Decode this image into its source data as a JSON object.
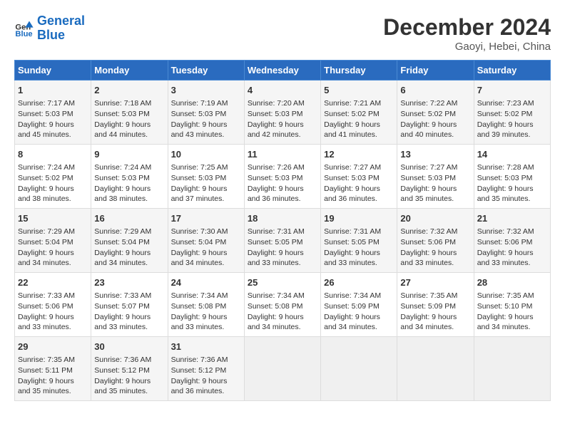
{
  "header": {
    "logo_line1": "General",
    "logo_line2": "Blue",
    "month": "December 2024",
    "location": "Gaoyi, Hebei, China"
  },
  "weekdays": [
    "Sunday",
    "Monday",
    "Tuesday",
    "Wednesday",
    "Thursday",
    "Friday",
    "Saturday"
  ],
  "weeks": [
    [
      {
        "day": "1",
        "sunrise": "7:17 AM",
        "sunset": "5:03 PM",
        "daylight": "9 hours and 45 minutes."
      },
      {
        "day": "2",
        "sunrise": "7:18 AM",
        "sunset": "5:03 PM",
        "daylight": "9 hours and 44 minutes."
      },
      {
        "day": "3",
        "sunrise": "7:19 AM",
        "sunset": "5:03 PM",
        "daylight": "9 hours and 43 minutes."
      },
      {
        "day": "4",
        "sunrise": "7:20 AM",
        "sunset": "5:03 PM",
        "daylight": "9 hours and 42 minutes."
      },
      {
        "day": "5",
        "sunrise": "7:21 AM",
        "sunset": "5:02 PM",
        "daylight": "9 hours and 41 minutes."
      },
      {
        "day": "6",
        "sunrise": "7:22 AM",
        "sunset": "5:02 PM",
        "daylight": "9 hours and 40 minutes."
      },
      {
        "day": "7",
        "sunrise": "7:23 AM",
        "sunset": "5:02 PM",
        "daylight": "9 hours and 39 minutes."
      }
    ],
    [
      {
        "day": "8",
        "sunrise": "7:24 AM",
        "sunset": "5:02 PM",
        "daylight": "9 hours and 38 minutes."
      },
      {
        "day": "9",
        "sunrise": "7:24 AM",
        "sunset": "5:03 PM",
        "daylight": "9 hours and 38 minutes."
      },
      {
        "day": "10",
        "sunrise": "7:25 AM",
        "sunset": "5:03 PM",
        "daylight": "9 hours and 37 minutes."
      },
      {
        "day": "11",
        "sunrise": "7:26 AM",
        "sunset": "5:03 PM",
        "daylight": "9 hours and 36 minutes."
      },
      {
        "day": "12",
        "sunrise": "7:27 AM",
        "sunset": "5:03 PM",
        "daylight": "9 hours and 36 minutes."
      },
      {
        "day": "13",
        "sunrise": "7:27 AM",
        "sunset": "5:03 PM",
        "daylight": "9 hours and 35 minutes."
      },
      {
        "day": "14",
        "sunrise": "7:28 AM",
        "sunset": "5:03 PM",
        "daylight": "9 hours and 35 minutes."
      }
    ],
    [
      {
        "day": "15",
        "sunrise": "7:29 AM",
        "sunset": "5:04 PM",
        "daylight": "9 hours and 34 minutes."
      },
      {
        "day": "16",
        "sunrise": "7:29 AM",
        "sunset": "5:04 PM",
        "daylight": "9 hours and 34 minutes."
      },
      {
        "day": "17",
        "sunrise": "7:30 AM",
        "sunset": "5:04 PM",
        "daylight": "9 hours and 34 minutes."
      },
      {
        "day": "18",
        "sunrise": "7:31 AM",
        "sunset": "5:05 PM",
        "daylight": "9 hours and 33 minutes."
      },
      {
        "day": "19",
        "sunrise": "7:31 AM",
        "sunset": "5:05 PM",
        "daylight": "9 hours and 33 minutes."
      },
      {
        "day": "20",
        "sunrise": "7:32 AM",
        "sunset": "5:06 PM",
        "daylight": "9 hours and 33 minutes."
      },
      {
        "day": "21",
        "sunrise": "7:32 AM",
        "sunset": "5:06 PM",
        "daylight": "9 hours and 33 minutes."
      }
    ],
    [
      {
        "day": "22",
        "sunrise": "7:33 AM",
        "sunset": "5:06 PM",
        "daylight": "9 hours and 33 minutes."
      },
      {
        "day": "23",
        "sunrise": "7:33 AM",
        "sunset": "5:07 PM",
        "daylight": "9 hours and 33 minutes."
      },
      {
        "day": "24",
        "sunrise": "7:34 AM",
        "sunset": "5:08 PM",
        "daylight": "9 hours and 33 minutes."
      },
      {
        "day": "25",
        "sunrise": "7:34 AM",
        "sunset": "5:08 PM",
        "daylight": "9 hours and 34 minutes."
      },
      {
        "day": "26",
        "sunrise": "7:34 AM",
        "sunset": "5:09 PM",
        "daylight": "9 hours and 34 minutes."
      },
      {
        "day": "27",
        "sunrise": "7:35 AM",
        "sunset": "5:09 PM",
        "daylight": "9 hours and 34 minutes."
      },
      {
        "day": "28",
        "sunrise": "7:35 AM",
        "sunset": "5:10 PM",
        "daylight": "9 hours and 34 minutes."
      }
    ],
    [
      {
        "day": "29",
        "sunrise": "7:35 AM",
        "sunset": "5:11 PM",
        "daylight": "9 hours and 35 minutes."
      },
      {
        "day": "30",
        "sunrise": "7:36 AM",
        "sunset": "5:12 PM",
        "daylight": "9 hours and 35 minutes."
      },
      {
        "day": "31",
        "sunrise": "7:36 AM",
        "sunset": "5:12 PM",
        "daylight": "9 hours and 36 minutes."
      },
      null,
      null,
      null,
      null
    ]
  ]
}
